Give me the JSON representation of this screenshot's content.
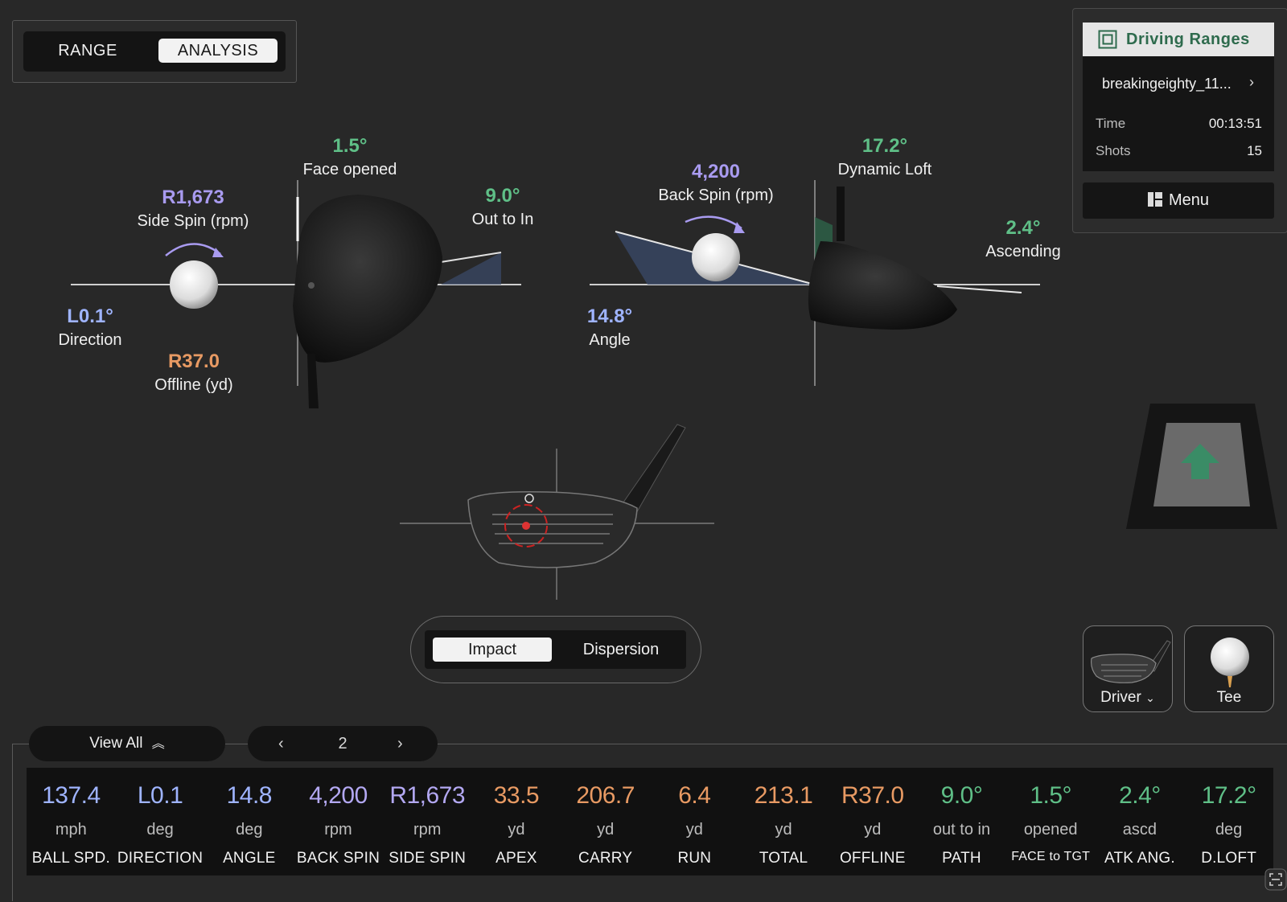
{
  "mode_toggle": {
    "range": "RANGE",
    "analysis": "ANALYSIS",
    "active": "ANALYSIS"
  },
  "top_view": {
    "face_angle": {
      "value": "1.5°",
      "label": "Face opened"
    },
    "side_spin": {
      "value": "R1,673",
      "label": "Side Spin (rpm)"
    },
    "path": {
      "value": "9.0°",
      "label": "Out to In"
    },
    "direction": {
      "value": "L0.1°",
      "label": "Direction"
    },
    "offline": {
      "value": "R37.0",
      "label": "Offline (yd)"
    }
  },
  "side_view": {
    "back_spin": {
      "value": "4,200",
      "label": "Back Spin (rpm)"
    },
    "dynamic_loft": {
      "value": "17.2°",
      "label": "Dynamic Loft"
    },
    "attack_angle": {
      "value": "2.4°",
      "label": "Ascending"
    },
    "launch_angle": {
      "value": "14.8°",
      "label": "Angle"
    }
  },
  "driving_ranges": {
    "title": "Driving Ranges",
    "icon": "range-grid-icon",
    "session": "breakingeighty_11...",
    "time_label": "Time",
    "time_value": "00:13:51",
    "shots_label": "Shots",
    "shots_value": "15",
    "menu_label": "Menu"
  },
  "view_toggle": {
    "impact": "Impact",
    "dispersion": "Dispersion",
    "active": "Impact"
  },
  "club_selector": {
    "label": "Driver"
  },
  "tee_selector": {
    "label": "Tee"
  },
  "list_controls": {
    "view_all": "View All",
    "page": "2"
  },
  "colors": {
    "purple": "#a99bf0",
    "green": "#5fbf87",
    "blue": "#9fb4ff",
    "orange": "#e89a63",
    "brand_green": "#2e6b4d"
  },
  "metrics": [
    {
      "value": "137.4",
      "unit": "mph",
      "label": "BALL SPD.",
      "color": "#9fb4ff"
    },
    {
      "value": "L0.1",
      "unit": "deg",
      "label": "DIRECTION",
      "color": "#9fb4ff"
    },
    {
      "value": "14.8",
      "unit": "deg",
      "label": "ANGLE",
      "color": "#9fb4ff"
    },
    {
      "value": "4,200",
      "unit": "rpm",
      "label": "BACK SPIN",
      "color": "#b3a8f2"
    },
    {
      "value": "R1,673",
      "unit": "rpm",
      "label": "SIDE SPIN",
      "color": "#b3a8f2"
    },
    {
      "value": "33.5",
      "unit": "yd",
      "label": "APEX",
      "color": "#e89a63"
    },
    {
      "value": "206.7",
      "unit": "yd",
      "label": "CARRY",
      "color": "#e89a63"
    },
    {
      "value": "6.4",
      "unit": "yd",
      "label": "RUN",
      "color": "#e89a63"
    },
    {
      "value": "213.1",
      "unit": "yd",
      "label": "TOTAL",
      "color": "#e89a63"
    },
    {
      "value": "R37.0",
      "unit": "yd",
      "label": "OFFLINE",
      "color": "#e89a63"
    },
    {
      "value": "9.0°",
      "unit": "out to in",
      "label": "PATH",
      "color": "#5fbf87"
    },
    {
      "value": "1.5°",
      "unit": "opened",
      "label": "FACE to TGT",
      "color": "#5fbf87"
    },
    {
      "value": "2.4°",
      "unit": "ascd",
      "label": "ATK ANG.",
      "color": "#5fbf87"
    },
    {
      "value": "17.2°",
      "unit": "deg",
      "label": "D.LOFT",
      "color": "#5fbf87"
    }
  ]
}
